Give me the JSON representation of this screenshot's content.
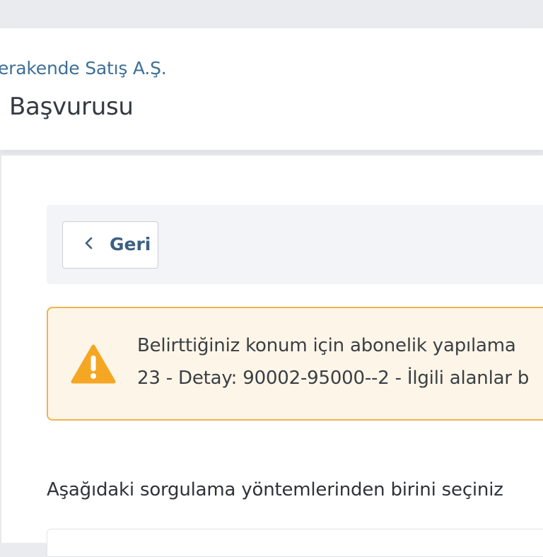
{
  "header": {
    "company": "erakende Satış A.Ş.",
    "title": ". Başvurusu"
  },
  "back_button": {
    "label": "Geri",
    "icon": "chevron-left-icon"
  },
  "alert": {
    "icon": "warning-icon",
    "line1": "Belirttiğiniz konum için abonelik yapılama",
    "line2": "23 - Detay: 90002-95000--2 - İlgili alanlar b",
    "accent_color": "#f0a020"
  },
  "instruction": "Aşağıdaki sorgulama yöntemlerinden birini seçiniz"
}
